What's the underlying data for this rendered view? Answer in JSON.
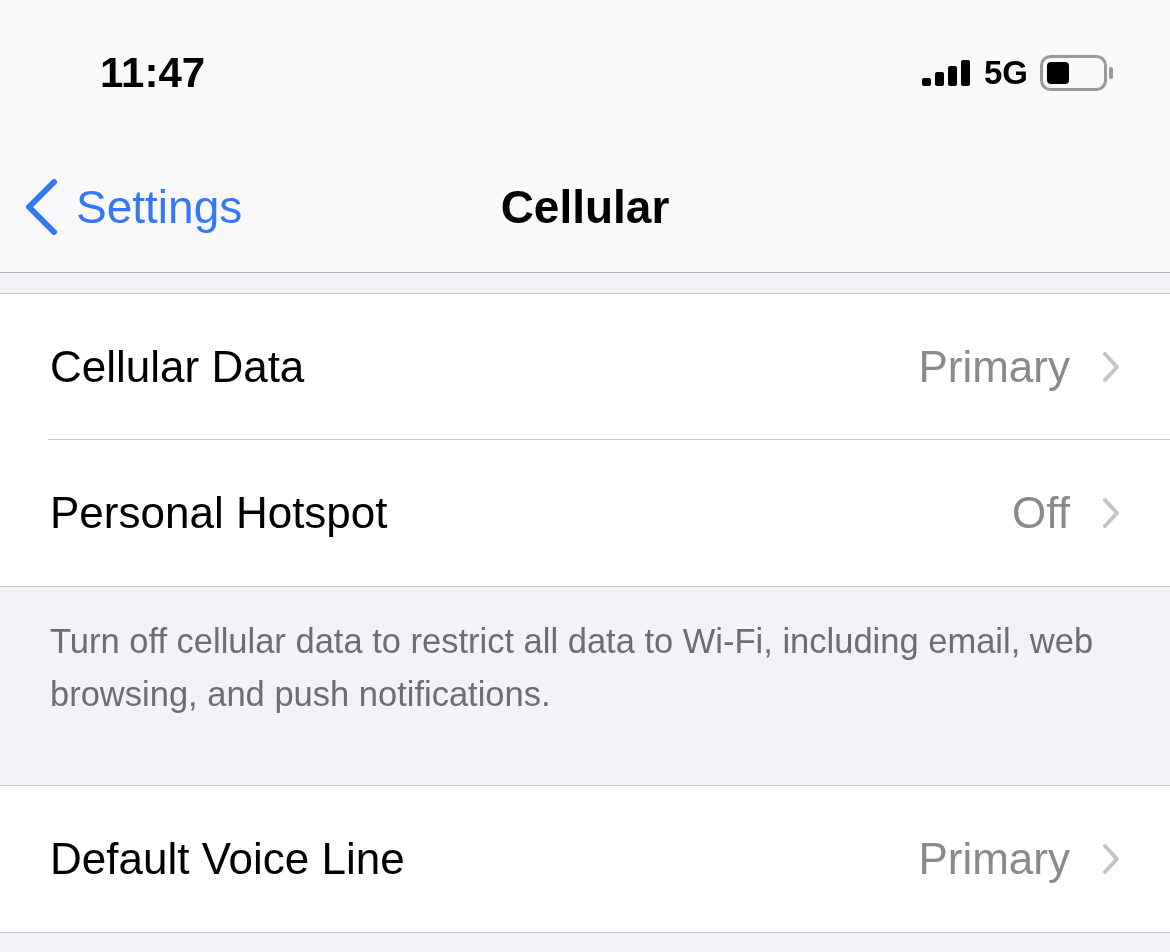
{
  "status_bar": {
    "time": "11:47",
    "network": "5G"
  },
  "nav": {
    "back": "Settings",
    "title": "Cellular"
  },
  "sections": [
    {
      "rows": [
        {
          "label": "Cellular Data",
          "value": "Primary"
        },
        {
          "label": "Personal Hotspot",
          "value": "Off"
        }
      ],
      "footer": "Turn off cellular data to restrict all data to Wi-Fi, including email, web browsing, and push notifications."
    },
    {
      "rows": [
        {
          "label": "Default Voice Line",
          "value": "Primary"
        }
      ]
    }
  ]
}
